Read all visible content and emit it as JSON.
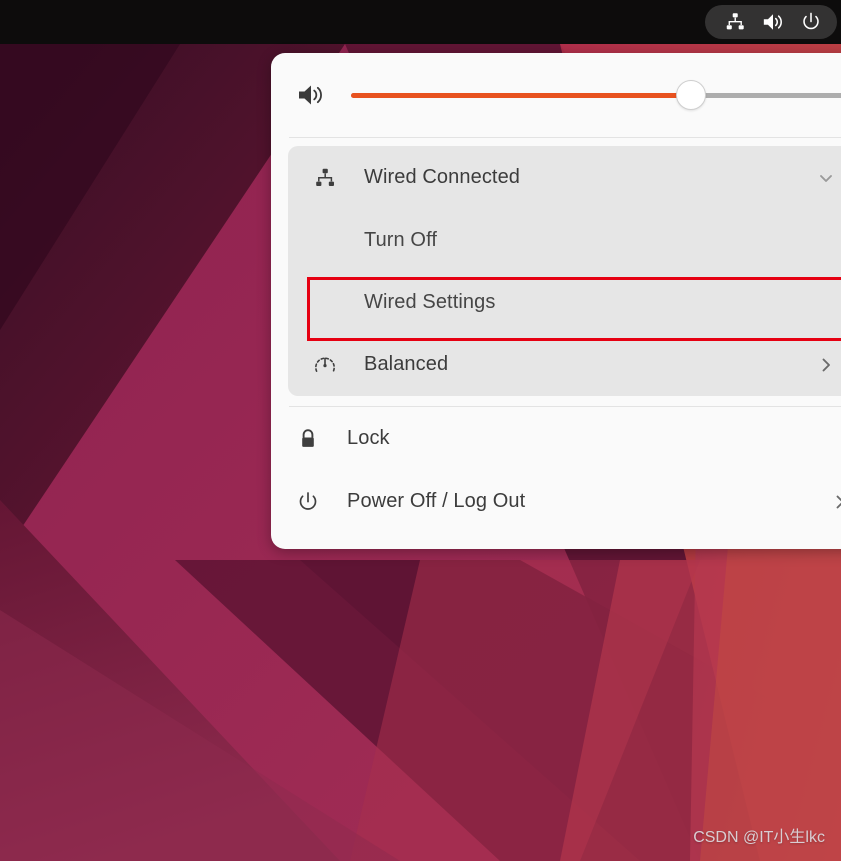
{
  "topbar": {
    "icons": [
      {
        "name": "network-wired-icon",
        "label": "Wired network"
      },
      {
        "name": "volume-speaker-icon",
        "label": "Volume"
      },
      {
        "name": "power-icon",
        "label": "System menu"
      }
    ],
    "background_color": "#0d0c0c",
    "pill_color": "#333232"
  },
  "menu": {
    "background_color": "#fafafa",
    "group_background_color": "#e6e6e6",
    "volume": {
      "icon": "volume-high-icon",
      "value_percent": 68,
      "fill_color": "#e8521f",
      "track_color": "#adadad",
      "handle_color": "#ffffff"
    },
    "network": {
      "icon": "network-wired-icon",
      "label": "Wired Connected",
      "chevron": "chevron-down-icon",
      "expanded": true,
      "submenu": [
        {
          "label": "Turn Off",
          "name": "menu-item-turn-off"
        },
        {
          "label": "Wired Settings",
          "name": "menu-item-wired-settings",
          "highlighted": true
        }
      ]
    },
    "power_profile": {
      "icon": "speedometer-icon",
      "label": "Balanced",
      "chevron": "chevron-right-icon"
    },
    "lock": {
      "icon": "lock-icon",
      "label": "Lock"
    },
    "power": {
      "icon": "power-icon",
      "label": "Power Off / Log Out",
      "chevron": "chevron-right-icon"
    }
  },
  "annotation": {
    "name": "red-highlight-box",
    "color": "#e60012",
    "targets": "Wired Settings"
  },
  "watermark": {
    "text": "CSDN @IT小生lkc",
    "color": "#d9cdd2"
  },
  "wallpaper": {
    "name": "ubuntu-origami-wallpaper",
    "colors": [
      "#3d0f26",
      "#8d2150",
      "#5c1333",
      "#b23751",
      "#c0392f",
      "#701a3a"
    ]
  }
}
